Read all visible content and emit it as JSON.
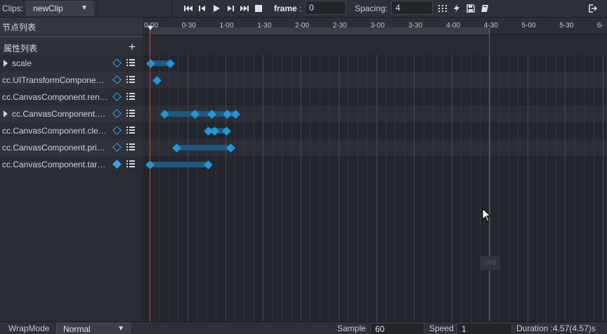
{
  "toolbar": {
    "clips_label": "Clips:",
    "clip_value": "newClip",
    "frame_label": "frame",
    "frame_colon": ":",
    "frame_value": "0",
    "spacing_label": "Spacing:",
    "spacing_value": "4"
  },
  "left_panel": {
    "nodes_title": "节点列表",
    "props_title": "属性列表",
    "add_label": "+",
    "rows": [
      {
        "label": "scale",
        "expandable": true,
        "keyed": false
      },
      {
        "label": "cc.UITransformComponent.contentSize",
        "expandable": false,
        "keyed": false
      },
      {
        "label": "cc.CanvasComponent.renderMode",
        "expandable": false,
        "keyed": false
      },
      {
        "label": "cc.CanvasComponent.color",
        "expandable": true,
        "keyed": false
      },
      {
        "label": "cc.CanvasComponent.clearFlag",
        "expandable": false,
        "keyed": false
      },
      {
        "label": "cc.CanvasComponent.priority",
        "expandable": false,
        "keyed": false
      },
      {
        "label": "cc.CanvasComponent.targetTexture",
        "expandable": false,
        "keyed": true
      }
    ]
  },
  "ruler": {
    "labels": [
      "0-00",
      "0-30",
      "1-00",
      "1-30",
      "2-00",
      "2-30",
      "3-00",
      "3-30",
      "4-00",
      "4-30",
      "5-00",
      "5-30",
      "6-"
    ]
  },
  "tracks": [
    {
      "keys": [
        0.1,
        2.2
      ],
      "bar": [
        0.1,
        2.2
      ]
    },
    {
      "keys": [
        0.8
      ],
      "bar": null
    },
    {
      "keys": [],
      "bar": null
    },
    {
      "keys": [
        1.6,
        4.8,
        6.6,
        8.2,
        9.1
      ],
      "bar": [
        1.6,
        9.1
      ]
    },
    {
      "keys": [
        6.2,
        6.85,
        8.15
      ],
      "bar": [
        6.2,
        8.15
      ]
    },
    {
      "keys": [
        2.9,
        8.6
      ],
      "bar": [
        2.9,
        8.6
      ]
    },
    {
      "keys": [
        0.0,
        6.2
      ],
      "bar": [
        0.0,
        6.2
      ]
    }
  ],
  "hover_tag": "268",
  "bottom": {
    "wrapmode_label": "WrapMode",
    "wrapmode_value": "Normal",
    "sample_label": "Sample",
    "sample_value": "60",
    "speed_label": "Speed",
    "speed_value": "1",
    "duration_text": "Duration :4.57(4.57)s"
  },
  "icons": {
    "first": "jump-first-icon",
    "prev": "prev-frame-icon",
    "play": "play-icon",
    "next": "next-frame-icon",
    "last": "jump-last-icon",
    "stop": "stop-icon",
    "grid": "grid-icon",
    "event": "lightning-icon",
    "save": "save-icon",
    "book": "book-icon",
    "exit": "exit-icon"
  }
}
